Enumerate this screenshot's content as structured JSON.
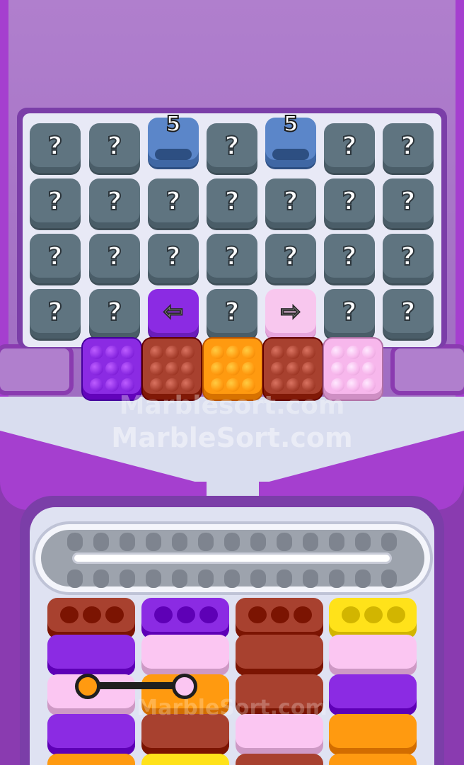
{
  "watermark": {
    "line1": "Marblesort.com",
    "line2": "MarbleSort.com",
    "line3": "MarbleSort.com"
  },
  "colors": {
    "purple": "#8b2be3",
    "brown": "#a8412f",
    "orange": "#ff9a10",
    "pink": "#f7b7ec",
    "yellow": "#ffe21a",
    "light_pink": "#fbc6f2"
  },
  "grid": {
    "rows": [
      [
        {
          "type": "mystery",
          "label": "?"
        },
        {
          "type": "mystery",
          "label": "?"
        },
        {
          "type": "tube",
          "label": "5"
        },
        {
          "type": "mystery",
          "label": "?"
        },
        {
          "type": "tube",
          "label": "5"
        },
        {
          "type": "mystery",
          "label": "?"
        },
        {
          "type": "mystery",
          "label": "?"
        }
      ],
      [
        {
          "type": "mystery",
          "label": "?"
        },
        {
          "type": "mystery",
          "label": "?"
        },
        {
          "type": "mystery",
          "label": "?"
        },
        {
          "type": "mystery",
          "label": "?"
        },
        {
          "type": "mystery",
          "label": "?"
        },
        {
          "type": "mystery",
          "label": "?"
        },
        {
          "type": "mystery",
          "label": "?"
        }
      ],
      [
        {
          "type": "mystery",
          "label": "?"
        },
        {
          "type": "mystery",
          "label": "?"
        },
        {
          "type": "mystery",
          "label": "?"
        },
        {
          "type": "mystery",
          "label": "?"
        },
        {
          "type": "mystery",
          "label": "?"
        },
        {
          "type": "mystery",
          "label": "?"
        },
        {
          "type": "mystery",
          "label": "?"
        }
      ],
      [
        {
          "type": "mystery",
          "label": "?"
        },
        {
          "type": "mystery",
          "label": "?"
        },
        {
          "type": "arrow-left",
          "label": "⇦"
        },
        {
          "type": "mystery",
          "label": "?"
        },
        {
          "type": "arrow-right",
          "label": "⇨"
        },
        {
          "type": "mystery",
          "label": "?"
        },
        {
          "type": "mystery",
          "label": "?"
        }
      ]
    ]
  },
  "marble_blocks": [
    {
      "color": "purple",
      "marbles": 9
    },
    {
      "color": "brown",
      "marbles": 9
    },
    {
      "color": "orange",
      "marbles": 9
    },
    {
      "color": "brown",
      "marbles": 9
    },
    {
      "color": "pink",
      "marbles": 9
    }
  ],
  "stacks": [
    {
      "top_color": "brown",
      "pieces": [
        "purple",
        "light_pink",
        "purple",
        "orange"
      ]
    },
    {
      "top_color": "purple",
      "pieces": [
        "light_pink",
        "orange",
        "brown",
        "yellow"
      ]
    },
    {
      "top_color": "brown",
      "pieces": [
        "brown",
        "brown",
        "light_pink",
        "brown"
      ]
    },
    {
      "top_color": "yellow",
      "pieces": [
        "light_pink",
        "purple",
        "orange",
        "orange"
      ]
    }
  ],
  "link": {
    "from_color": "orange",
    "to_color": "light_pink"
  }
}
